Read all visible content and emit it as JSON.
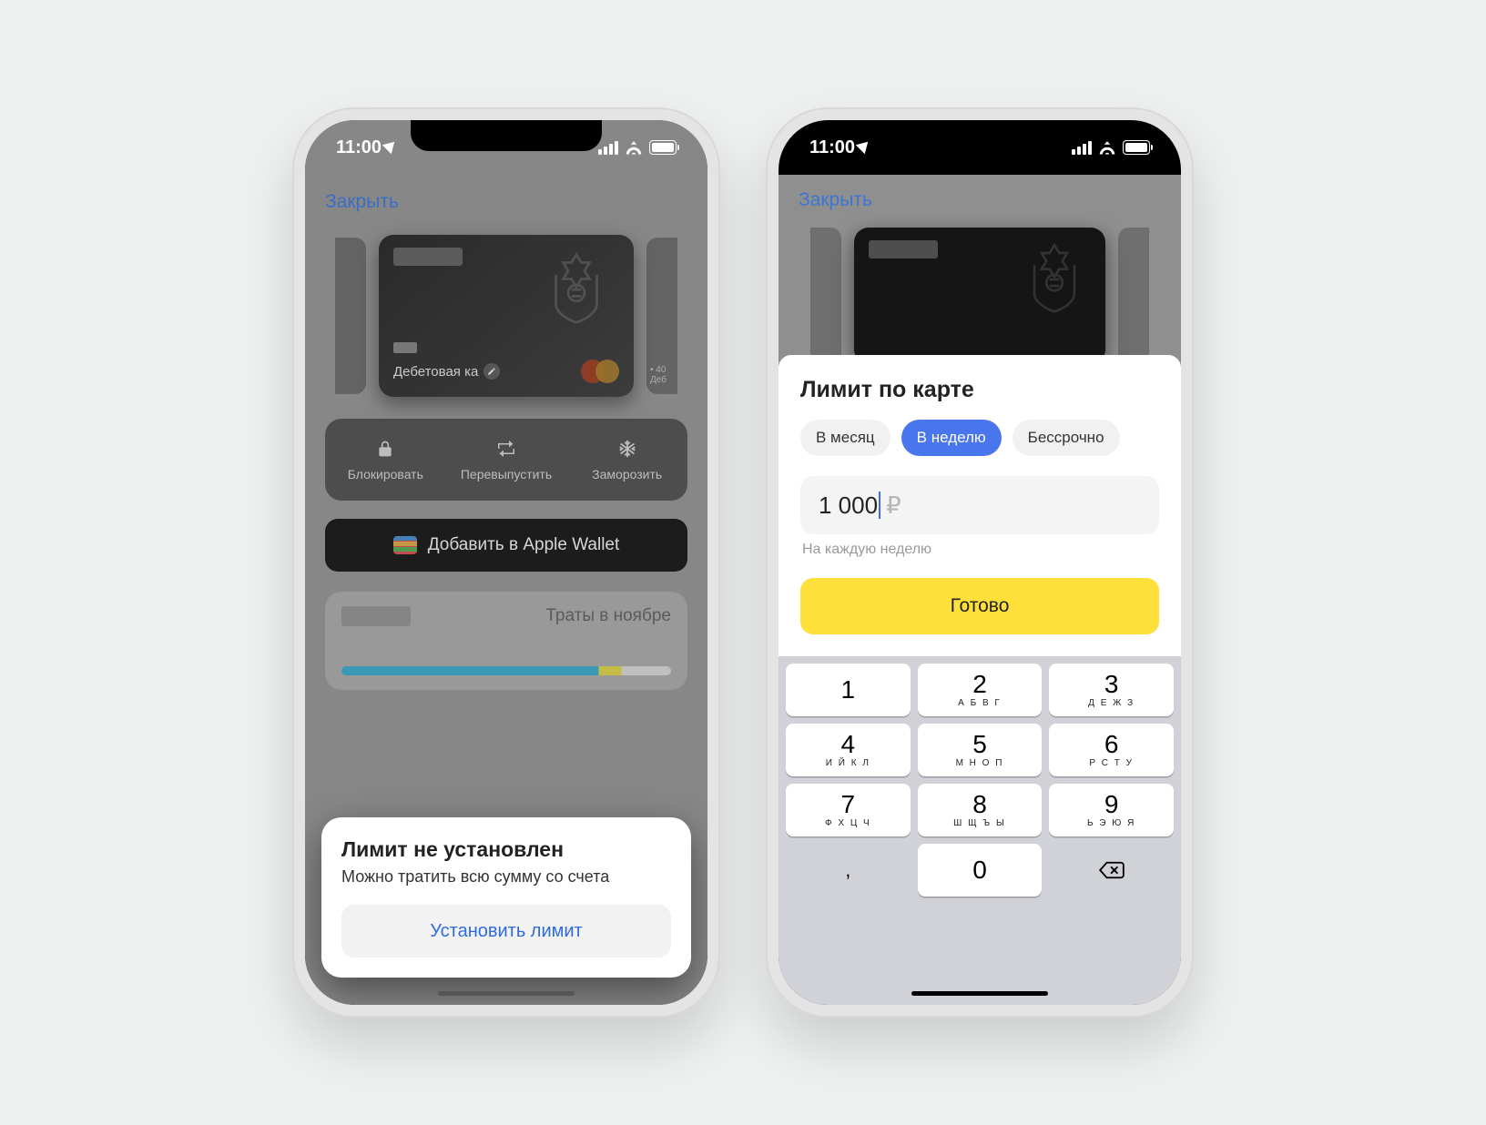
{
  "status": {
    "time": "11:00"
  },
  "phone1": {
    "close": "Закрыть",
    "card_label": "Дебетовая ка",
    "side_right_number": "• 40",
    "side_right_label": "Деб",
    "actions": {
      "block": "Блокировать",
      "reissue": "Перевыпустить",
      "freeze": "Заморозить"
    },
    "wallet": "Добавить в Apple Wallet",
    "spend_label": "Траты в ноябре",
    "limit": {
      "title": "Лимит не установлен",
      "subtitle": "Можно тратить всю сумму со счета",
      "button": "Установить лимит"
    }
  },
  "phone2": {
    "close": "Закрыть",
    "sheet_title": "Лимит по карте",
    "segments": {
      "month": "В месяц",
      "week": "В неделю",
      "forever": "Бессрочно"
    },
    "amount_value": "1 000",
    "currency": "₽",
    "hint": "На каждую неделю",
    "done": "Готово",
    "keypad": {
      "1": {
        "d": "1",
        "l": ""
      },
      "2": {
        "d": "2",
        "l": "А Б В Г"
      },
      "3": {
        "d": "3",
        "l": "Д Е Ж З"
      },
      "4": {
        "d": "4",
        "l": "И Й К Л"
      },
      "5": {
        "d": "5",
        "l": "М Н О П"
      },
      "6": {
        "d": "6",
        "l": "Р С Т У"
      },
      "7": {
        "d": "7",
        "l": "Ф Х Ц Ч"
      },
      "8": {
        "d": "8",
        "l": "Ш Щ Ъ Ы"
      },
      "9": {
        "d": "9",
        "l": "Ь Э Ю Я"
      },
      "0": {
        "d": "0",
        "l": ""
      },
      "comma": ","
    }
  }
}
